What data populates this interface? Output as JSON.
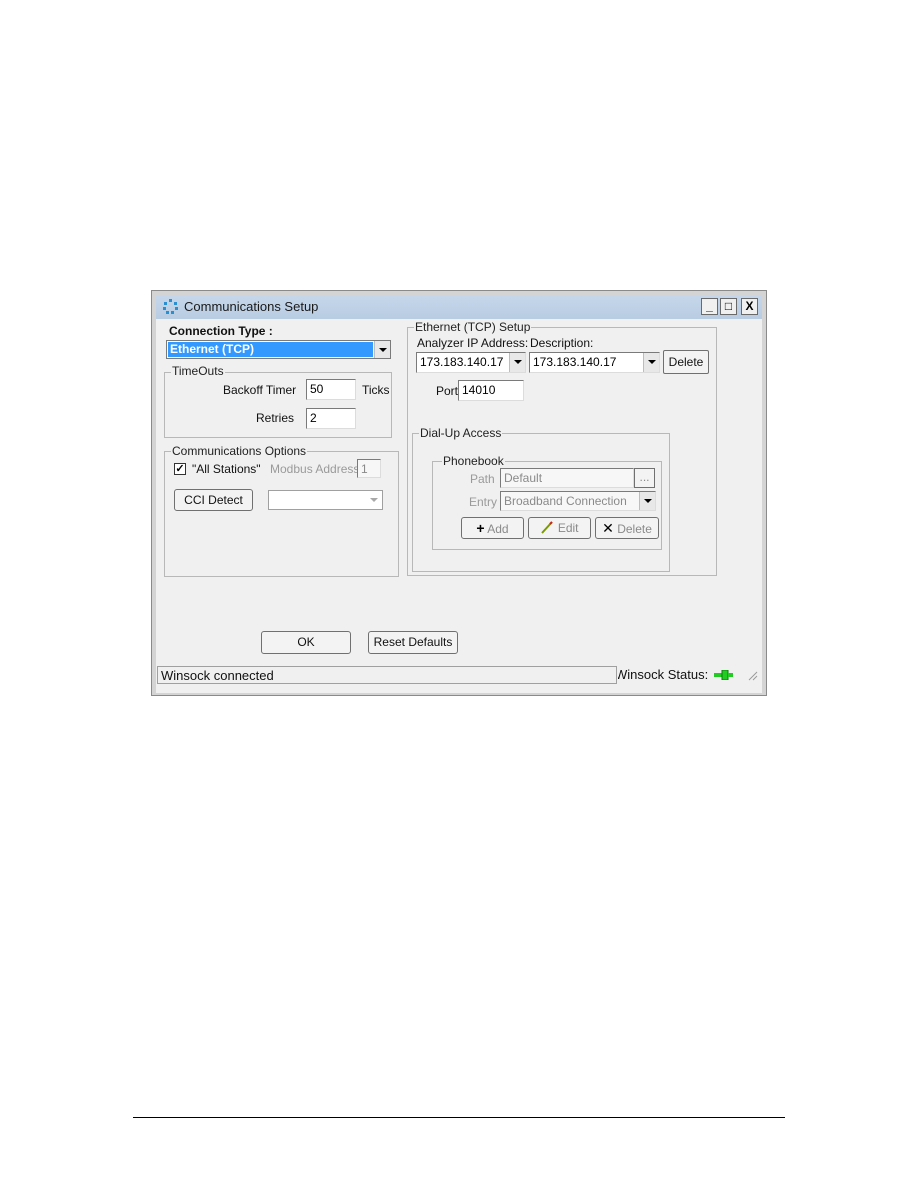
{
  "window": {
    "title": "Communications Setup",
    "controls": {
      "minimize": "_",
      "maximize": "□",
      "close": "X"
    }
  },
  "connection": {
    "label": "Connection Type :",
    "selected": "Ethernet (TCP)"
  },
  "timeouts": {
    "title": "TimeOuts",
    "backoff_label": "Backoff Timer",
    "backoff_value": "50",
    "backoff_unit": "Ticks",
    "retries_label": "Retries",
    "retries_value": "2"
  },
  "comm_options": {
    "title": "Communications Options",
    "all_stations_label": "\"All Stations\"",
    "all_stations_checked": true,
    "modbus_label": "Modbus Address",
    "modbus_value": "1",
    "cci_button": "CCI Detect",
    "cci_select_value": ""
  },
  "ethernet": {
    "title": "Ethernet (TCP)  Setup",
    "ip_label": "Analyzer IP Address:",
    "ip_value": "173.183.140.17",
    "desc_label": "Description:",
    "desc_value": "173.183.140.17",
    "delete_button": "Delete",
    "port_label": "Port",
    "port_value": "14010"
  },
  "dialup": {
    "title": "Dial-Up Access",
    "phonebook_title": "Phonebook",
    "path_label": "Path",
    "path_value": "Default",
    "browse_button": "...",
    "entry_label": "Entry",
    "entry_value": "Broadband Connection",
    "add_button": "Add",
    "edit_button": "Edit",
    "delete_button": "Delete"
  },
  "buttons": {
    "ok": "OK",
    "reset": "Reset Defaults"
  },
  "statusbar": {
    "message": "Winsock connected",
    "status_label": "Winsock Status:",
    "status_color": "#22cc22"
  }
}
